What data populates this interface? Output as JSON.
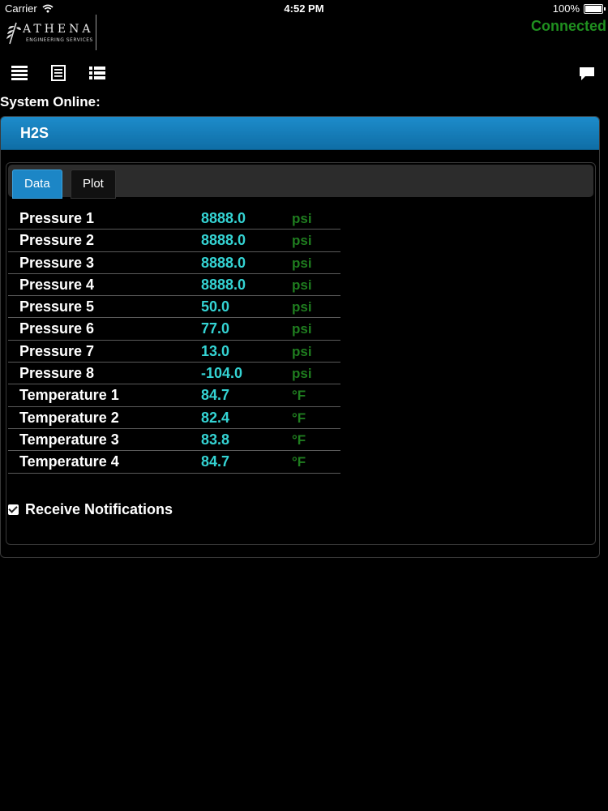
{
  "status_bar": {
    "carrier": "Carrier",
    "time": "4:52 PM",
    "battery": "100%"
  },
  "header": {
    "logo_name": "ATHENA",
    "logo_sub": "ENGINEERING SERVICES",
    "connection": "Connected",
    "connection_color": "#1f8f1f"
  },
  "toolbar": {
    "icons": [
      "menu-lines-icon",
      "document-list-icon",
      "bullet-list-icon",
      "chat-bubble-icon"
    ]
  },
  "system_line": "System Online:",
  "panel": {
    "title": "H2S",
    "tabs": {
      "data": "Data",
      "plot": "Plot"
    },
    "readings": [
      {
        "label": "Pressure 1",
        "value": "8888.0",
        "unit": "psi"
      },
      {
        "label": "Pressure 2",
        "value": "8888.0",
        "unit": "psi"
      },
      {
        "label": "Pressure 3",
        "value": "8888.0",
        "unit": "psi"
      },
      {
        "label": "Pressure 4",
        "value": "8888.0",
        "unit": "psi"
      },
      {
        "label": "Pressure 5",
        "value": "50.0",
        "unit": "psi"
      },
      {
        "label": "Pressure 6",
        "value": "77.0",
        "unit": "psi"
      },
      {
        "label": "Pressure 7",
        "value": "13.0",
        "unit": "psi"
      },
      {
        "label": "Pressure 8",
        "value": "-104.0",
        "unit": "psi"
      },
      {
        "label": "Temperature 1",
        "value": "84.7",
        "unit": "°F"
      },
      {
        "label": "Temperature 2",
        "value": "82.4",
        "unit": "°F"
      },
      {
        "label": "Temperature 3",
        "value": "83.8",
        "unit": "°F"
      },
      {
        "label": "Temperature 4",
        "value": "84.7",
        "unit": "°F"
      }
    ],
    "notifications_label": "Receive Notifications",
    "notifications_checked": true
  },
  "colors": {
    "accent": "#1c86c6",
    "value": "#34d3d3",
    "unit": "#1f7d1f"
  }
}
